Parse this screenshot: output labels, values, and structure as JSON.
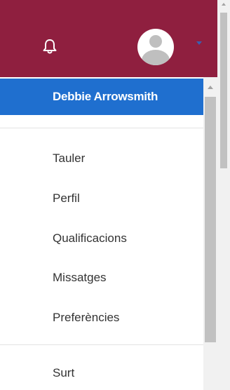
{
  "topbar": {
    "bg_color": "#8f1f3f",
    "notification_icon": "bell-icon",
    "avatar_icon": "user-avatar-icon",
    "caret_icon": "caret-down-icon"
  },
  "user_menu": {
    "user_name": "Debbie Arrowsmith",
    "header_color": "#1f6fcf",
    "items": [
      {
        "label": "Tauler"
      },
      {
        "label": "Perfil"
      },
      {
        "label": "Qualificacions"
      },
      {
        "label": "Missatges"
      },
      {
        "label": "Preferències"
      },
      {
        "label": "Surt"
      }
    ]
  }
}
